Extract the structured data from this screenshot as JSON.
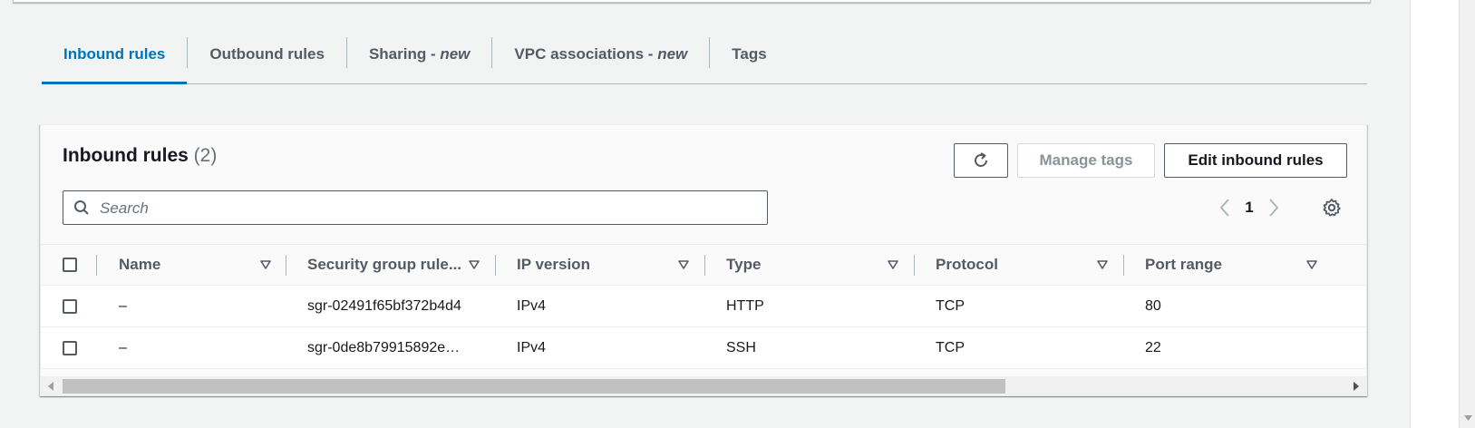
{
  "tabs": [
    {
      "label": "Inbound rules",
      "suffix": "",
      "active": true
    },
    {
      "label": "Outbound rules",
      "suffix": "",
      "active": false
    },
    {
      "label": "Sharing - ",
      "suffix": "new",
      "active": false
    },
    {
      "label": "VPC associations - ",
      "suffix": "new",
      "active": false
    },
    {
      "label": "Tags",
      "suffix": "",
      "active": false
    }
  ],
  "panel": {
    "title": "Inbound rules",
    "count": "(2)",
    "manage_tags_label": "Manage tags",
    "edit_label": "Edit inbound rules",
    "search_placeholder": "Search",
    "page": "1"
  },
  "table": {
    "columns": [
      "Name",
      "Security group rule...",
      "IP version",
      "Type",
      "Protocol",
      "Port range"
    ],
    "rows": [
      {
        "name": "–",
        "rule_id": "sgr-02491f65bf372b4d4",
        "ip_version": "IPv4",
        "type": "HTTP",
        "protocol": "TCP",
        "port_range": "80"
      },
      {
        "name": "–",
        "rule_id": "sgr-0de8b79915892e…",
        "ip_version": "IPv4",
        "type": "SSH",
        "protocol": "TCP",
        "port_range": "22"
      }
    ]
  },
  "colors": {
    "accent": "#0073bb",
    "text": "#16191f",
    "secondary_text": "#545b64",
    "background": "#f2f3f3"
  }
}
